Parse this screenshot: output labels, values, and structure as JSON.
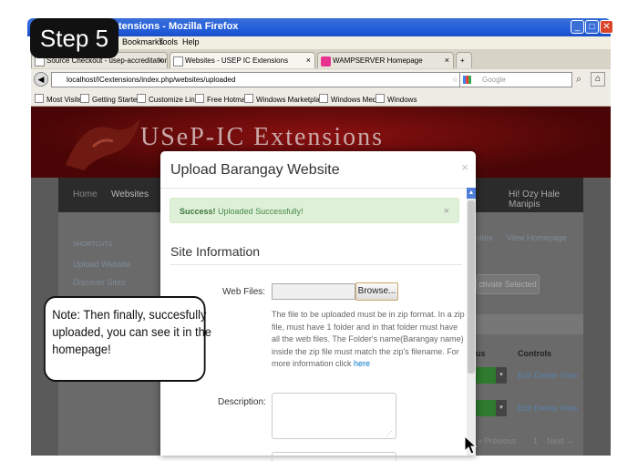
{
  "window": {
    "title": "Websites - USEP IC Extensions - Mozilla Firefox",
    "title_visible": "tensions - Mozilla Firefox"
  },
  "menu": [
    "Bookmarks",
    "Tools",
    "Help"
  ],
  "tabs": [
    {
      "label": "Source Checkout - usep-accreditation-sy..."
    },
    {
      "label": "Websites - USEP IC Extensions",
      "active": true
    },
    {
      "label": "WAMPSERVER Homepage"
    }
  ],
  "nav": {
    "url": "localhost/ICextensions/index.php/websites/uploaded",
    "search_placeholder": "Google"
  },
  "bookmarks": [
    "Most Visited",
    "Getting Started",
    "Customize Links",
    "Free Hotmail",
    "Windows Marketplace",
    "Windows Media",
    "Windows"
  ],
  "site": {
    "logo": "USeP-IC Extensions",
    "nav_home": "Home",
    "nav_websites": "Websites",
    "nav_user": "Hi! Ozy Hale Manipis",
    "sidebar_heading": "SHORTCUTS",
    "sidebar_links": [
      "Upload Website",
      "Discover Sites"
    ],
    "tab_sites": "sites",
    "tab_view_homepage": "View Homepage",
    "activate_selected": "ctivate Selected",
    "col_status": "us",
    "col_controls": "Controls",
    "row_actions": [
      "Edit Delete View",
      "Edit Delete View"
    ],
    "pager_previous": "« Previous",
    "pager_page": "1",
    "pager_next": "Next →"
  },
  "modal": {
    "title": "Upload Barangay Website",
    "close": "×",
    "alert_strong": "Success!",
    "alert_text": "Uploaded Successfully!",
    "alert_close": "×",
    "section_title": "Site Information",
    "web_files_label": "Web Files:",
    "browse_label": "Browse...",
    "help_text": "The file to be uploaded must be in zip format. In a zip file, must have 1 folder and in that folder must have all the web files. The Folder's name(Barangay name) inside the zip file must match the zip's filename. For more information click",
    "help_link": "here",
    "description_label": "Description:"
  },
  "overlay": {
    "step": "Step 5",
    "note": "Note: Then finally, succesfully uploaded, you can see it in the homepage!"
  }
}
